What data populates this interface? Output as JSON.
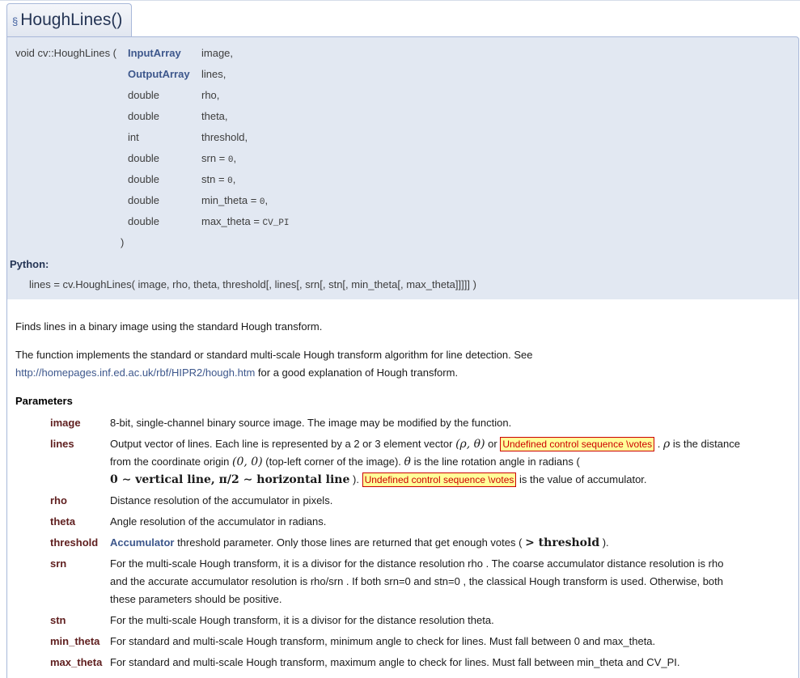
{
  "header": {
    "section_symbol": "§",
    "title": "HoughLines()"
  },
  "proto": {
    "fn_name": "void cv::HoughLines (",
    "params": [
      {
        "type": "InputArray",
        "name": "image,",
        "default": "",
        "type_is_link": true
      },
      {
        "type": "OutputArray",
        "name": "lines,",
        "default": "",
        "type_is_link": true
      },
      {
        "type": "double",
        "name": "rho,",
        "default": "",
        "type_is_link": false
      },
      {
        "type": "double",
        "name": "theta,",
        "default": "",
        "type_is_link": false
      },
      {
        "type": "int",
        "name": "threshold,",
        "default": "",
        "type_is_link": false
      },
      {
        "type": "double",
        "name": "srn = ",
        "default": "0",
        "suffix": ",",
        "type_is_link": false
      },
      {
        "type": "double",
        "name": "stn = ",
        "default": "0",
        "suffix": ",",
        "type_is_link": false
      },
      {
        "type": "double",
        "name": "min_theta = ",
        "default": "0",
        "suffix": ",",
        "type_is_link": false
      },
      {
        "type": "double",
        "name": "max_theta = ",
        "default": "CV_PI",
        "suffix": "",
        "type_is_link": false
      }
    ],
    "close_paren": ")",
    "python_label": "Python:",
    "python_sig": "lines = cv.HoughLines( image, rho, theta, threshold[, lines[, srn[, stn[, min_theta[, max_theta]]]]] )"
  },
  "doc": {
    "brief": "Finds lines in a binary image using the standard Hough transform.",
    "detail_1": "The function implements the standard or standard multi-scale Hough transform algorithm for line detection. See",
    "detail_link": "http://homepages.inf.ed.ac.uk/rbf/HIPR2/hough.htm",
    "detail_2": " for a good explanation of Hough transform.",
    "params_title": "Parameters",
    "params": {
      "image": {
        "name": "image",
        "desc": "8-bit, single-channel binary source image. The image may be modified by the function."
      },
      "lines": {
        "name": "lines",
        "l1a": "Output vector of lines. Each line is represented by a 2 or 3 element vector ",
        "l1m": "(ρ, θ)",
        "l1b": " or ",
        "err": "Undefined control sequence \\votes",
        "l1c": " . ",
        "l1rho": "ρ",
        "l1d": " is the distance",
        "l2a": "from the coordinate origin ",
        "l2m": "(0, 0)",
        "l2b": " (top-left corner of the image). ",
        "l2theta": "θ",
        "l2c": " is the line rotation angle in radians (",
        "l3a": "0 ∼ vertical line, π/2 ∼ horizontal line",
        "l3b": " ). ",
        "l3c": " is the value of accumulator."
      },
      "rho": {
        "name": "rho",
        "desc": "Distance resolution of the accumulator in pixels."
      },
      "theta": {
        "name": "theta",
        "desc": "Angle resolution of the accumulator in radians."
      },
      "threshold": {
        "name": "threshold",
        "link": "Accumulator",
        "desc_a": " threshold parameter. Only those lines are returned that get enough votes ( ",
        "math": "> threshold",
        "desc_b": " )."
      },
      "srn": {
        "name": "srn",
        "l1": "For the multi-scale Hough transform, it is a divisor for the distance resolution rho . The coarse accumulator distance resolution is rho",
        "l2": "and the accurate accumulator resolution is rho/srn . If both srn=0 and stn=0 , the classical Hough transform is used. Otherwise, both",
        "l3": "these parameters should be positive."
      },
      "stn": {
        "name": "stn",
        "desc": "For the multi-scale Hough transform, it is a divisor for the distance resolution theta."
      },
      "min_theta": {
        "name": "min_theta",
        "desc": "For standard and multi-scale Hough transform, minimum angle to check for lines. Must fall between 0 and max_theta."
      },
      "max_theta": {
        "name": "max_theta",
        "desc": "For standard and multi-scale Hough transform, maximum angle to check for lines. Must fall between min_theta and CV_PI."
      }
    }
  }
}
